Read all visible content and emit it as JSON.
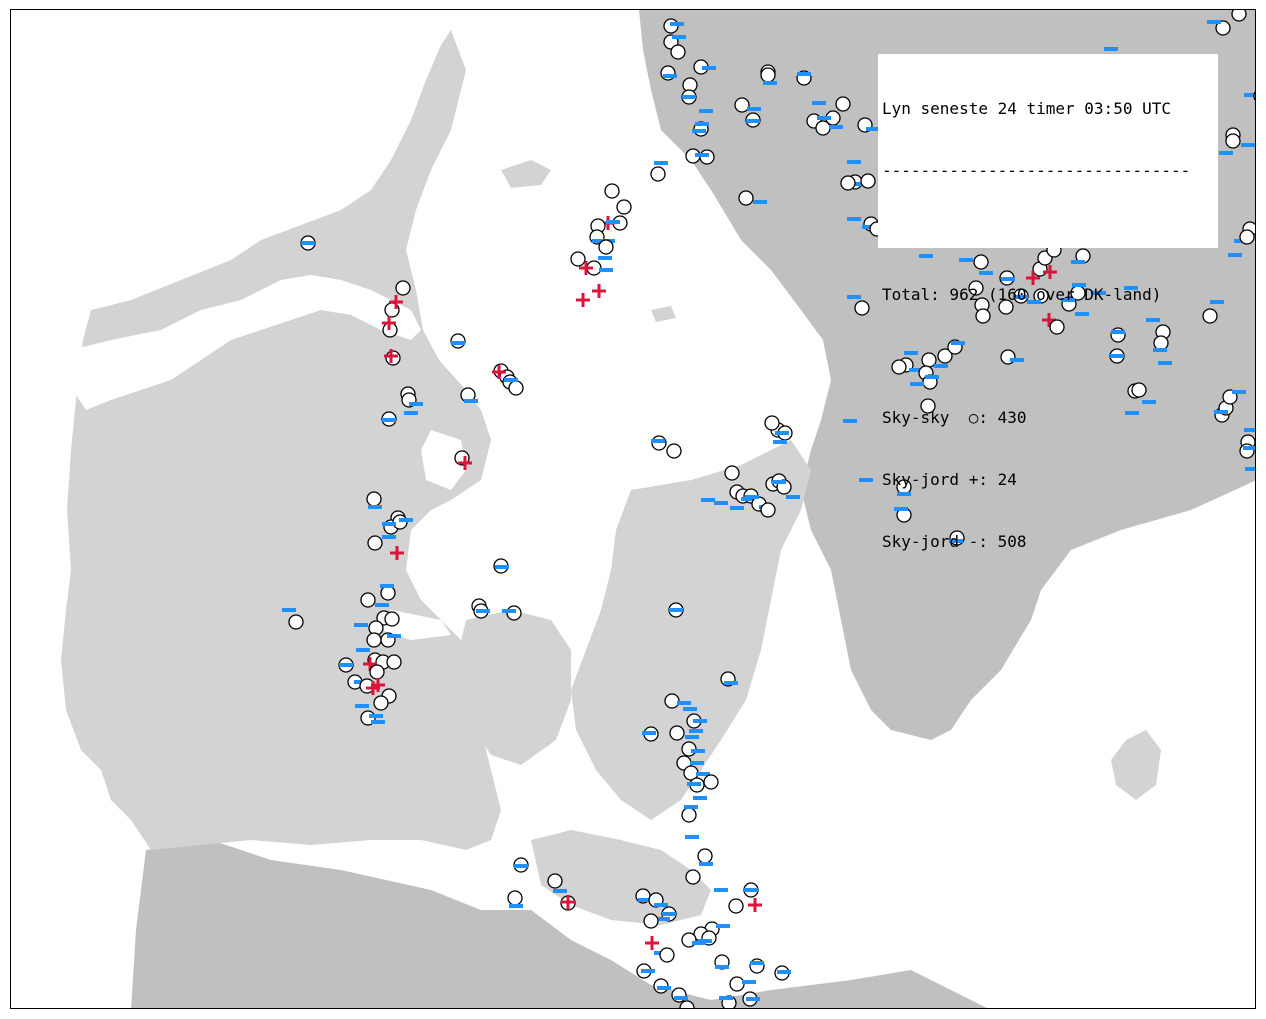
{
  "legend": {
    "title": "Lyn seneste 24 timer 03:50 UTC",
    "separator": "--------------------------------",
    "total": "Total: 962 (160 over DK-land)",
    "sky_sky": "Sky-sky  ○: 430",
    "sky_jord_pos": "Sky-jord +: 24",
    "sky_jord_neg": "Sky-jord -: 508"
  },
  "colors": {
    "denmark_land": "#d3d3d3",
    "foreign_land": "#c0c0c0",
    "sea": "#ffffff",
    "sky_sky_marker": "#ffffff",
    "positive_marker": "#dc143c",
    "negative_marker": "#1e90ff"
  },
  "icons": {
    "sky_sky": "circle-icon",
    "positive": "plus-icon",
    "negative": "minus-icon"
  }
}
